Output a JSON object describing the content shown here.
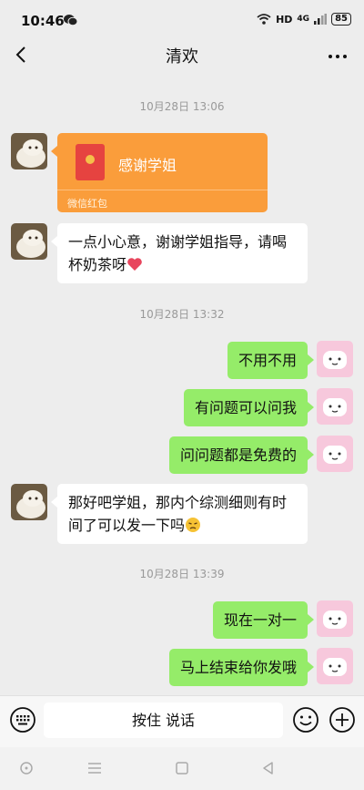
{
  "status_bar": {
    "time": "10:46",
    "network": "HD",
    "signal": "4G",
    "battery": "85"
  },
  "header": {
    "title": "清欢"
  },
  "messages": {
    "t1": "10月28日 13:06",
    "redpacket_title": "感谢学姐",
    "redpacket_label": "微信红包",
    "m1_line1": "一点小心意，谢谢学姐指导，请喝",
    "m1_line2": "杯奶茶呀",
    "t2": "10月28日 13:32",
    "m2": "不用不用",
    "m3": "有问题可以问我",
    "m4": "问问题都是免费的",
    "m5_line1": "那好吧学姐，那内个综测细则有时",
    "m5_line2": "间了可以发一下吗",
    "t3": "10月28日 13:39",
    "m6": "现在一对一",
    "m7": "马上结束给你发哦"
  },
  "input_bar": {
    "hold_to_talk": "按住 说话"
  },
  "colors": {
    "sent_bubble": "#95ec69",
    "received_bubble": "#ffffff",
    "redpacket": "#fa9d3b",
    "background": "#ededed"
  },
  "icons": [
    "back-arrow-icon",
    "more-icon",
    "keyboard-icon",
    "emoji-icon",
    "plus-icon",
    "heart-emoji-icon",
    "sad-emoji-icon"
  ]
}
